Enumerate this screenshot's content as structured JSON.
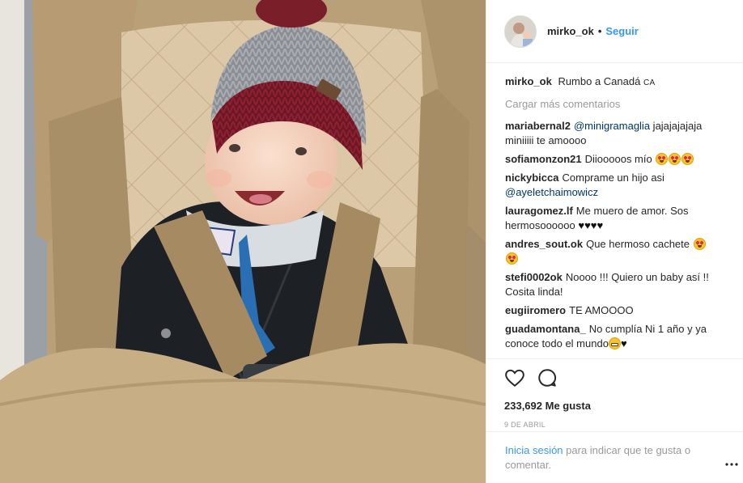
{
  "post": {
    "image_alt": "Bebé sonriente con gorro de lana en un cochecito",
    "author": "mirko_ok",
    "dot": "•",
    "follow_label": "Seguir",
    "caption_text": "Rumbo a Canadá",
    "caption_tag": "CA",
    "load_more": "Cargar más comentarios"
  },
  "comments": [
    {
      "user": "mariabernal2",
      "mention": "@minigramaglia",
      "text": " jajajajajaja miniiiii te amoooo"
    },
    {
      "user": "sofiamonzon21",
      "text": "Diiooooos mío",
      "emoji": [
        "heart-eyes",
        "heart-eyes",
        "heart-eyes"
      ]
    },
    {
      "user": "nickybicca",
      "text": "Comprame un hijo asi ",
      "mention": "@ayeletchaimowicz"
    },
    {
      "user": "lauragomez.lf",
      "text": "Me muero de amor. Sos hermosoooooo",
      "hearts": "♥♥♥♥"
    },
    {
      "user": "andres_sout.ok",
      "text": "Que hermoso cachete",
      "emoji": [
        "heart-eyes",
        "heart-eyes"
      ]
    },
    {
      "user": "stefi0002ok",
      "text": "Noooo !!! Quiero un baby así !! Cosita linda!"
    },
    {
      "user": "eugiiromero",
      "text": "TE AMOOOO"
    },
    {
      "user": "guadamontana_",
      "text": "No cumplía Ni 1 año y ya conoce todo el mundo",
      "hearts": "♥"
    }
  ],
  "actions": {
    "like_icon": "heart-outline-icon",
    "comment_icon": "speech-bubble-icon",
    "likes_count": "233,692",
    "likes_label": "Me gusta",
    "date": "9 de abril"
  },
  "footer": {
    "login_link": "Inicia sesión",
    "login_text": " para indicar que te gusta o comentar.",
    "more_icon": "more-options-icon"
  },
  "colors": {
    "link_blue": "#3897f0",
    "mention_blue": "#003569",
    "muted": "#999999",
    "text": "#262626"
  }
}
